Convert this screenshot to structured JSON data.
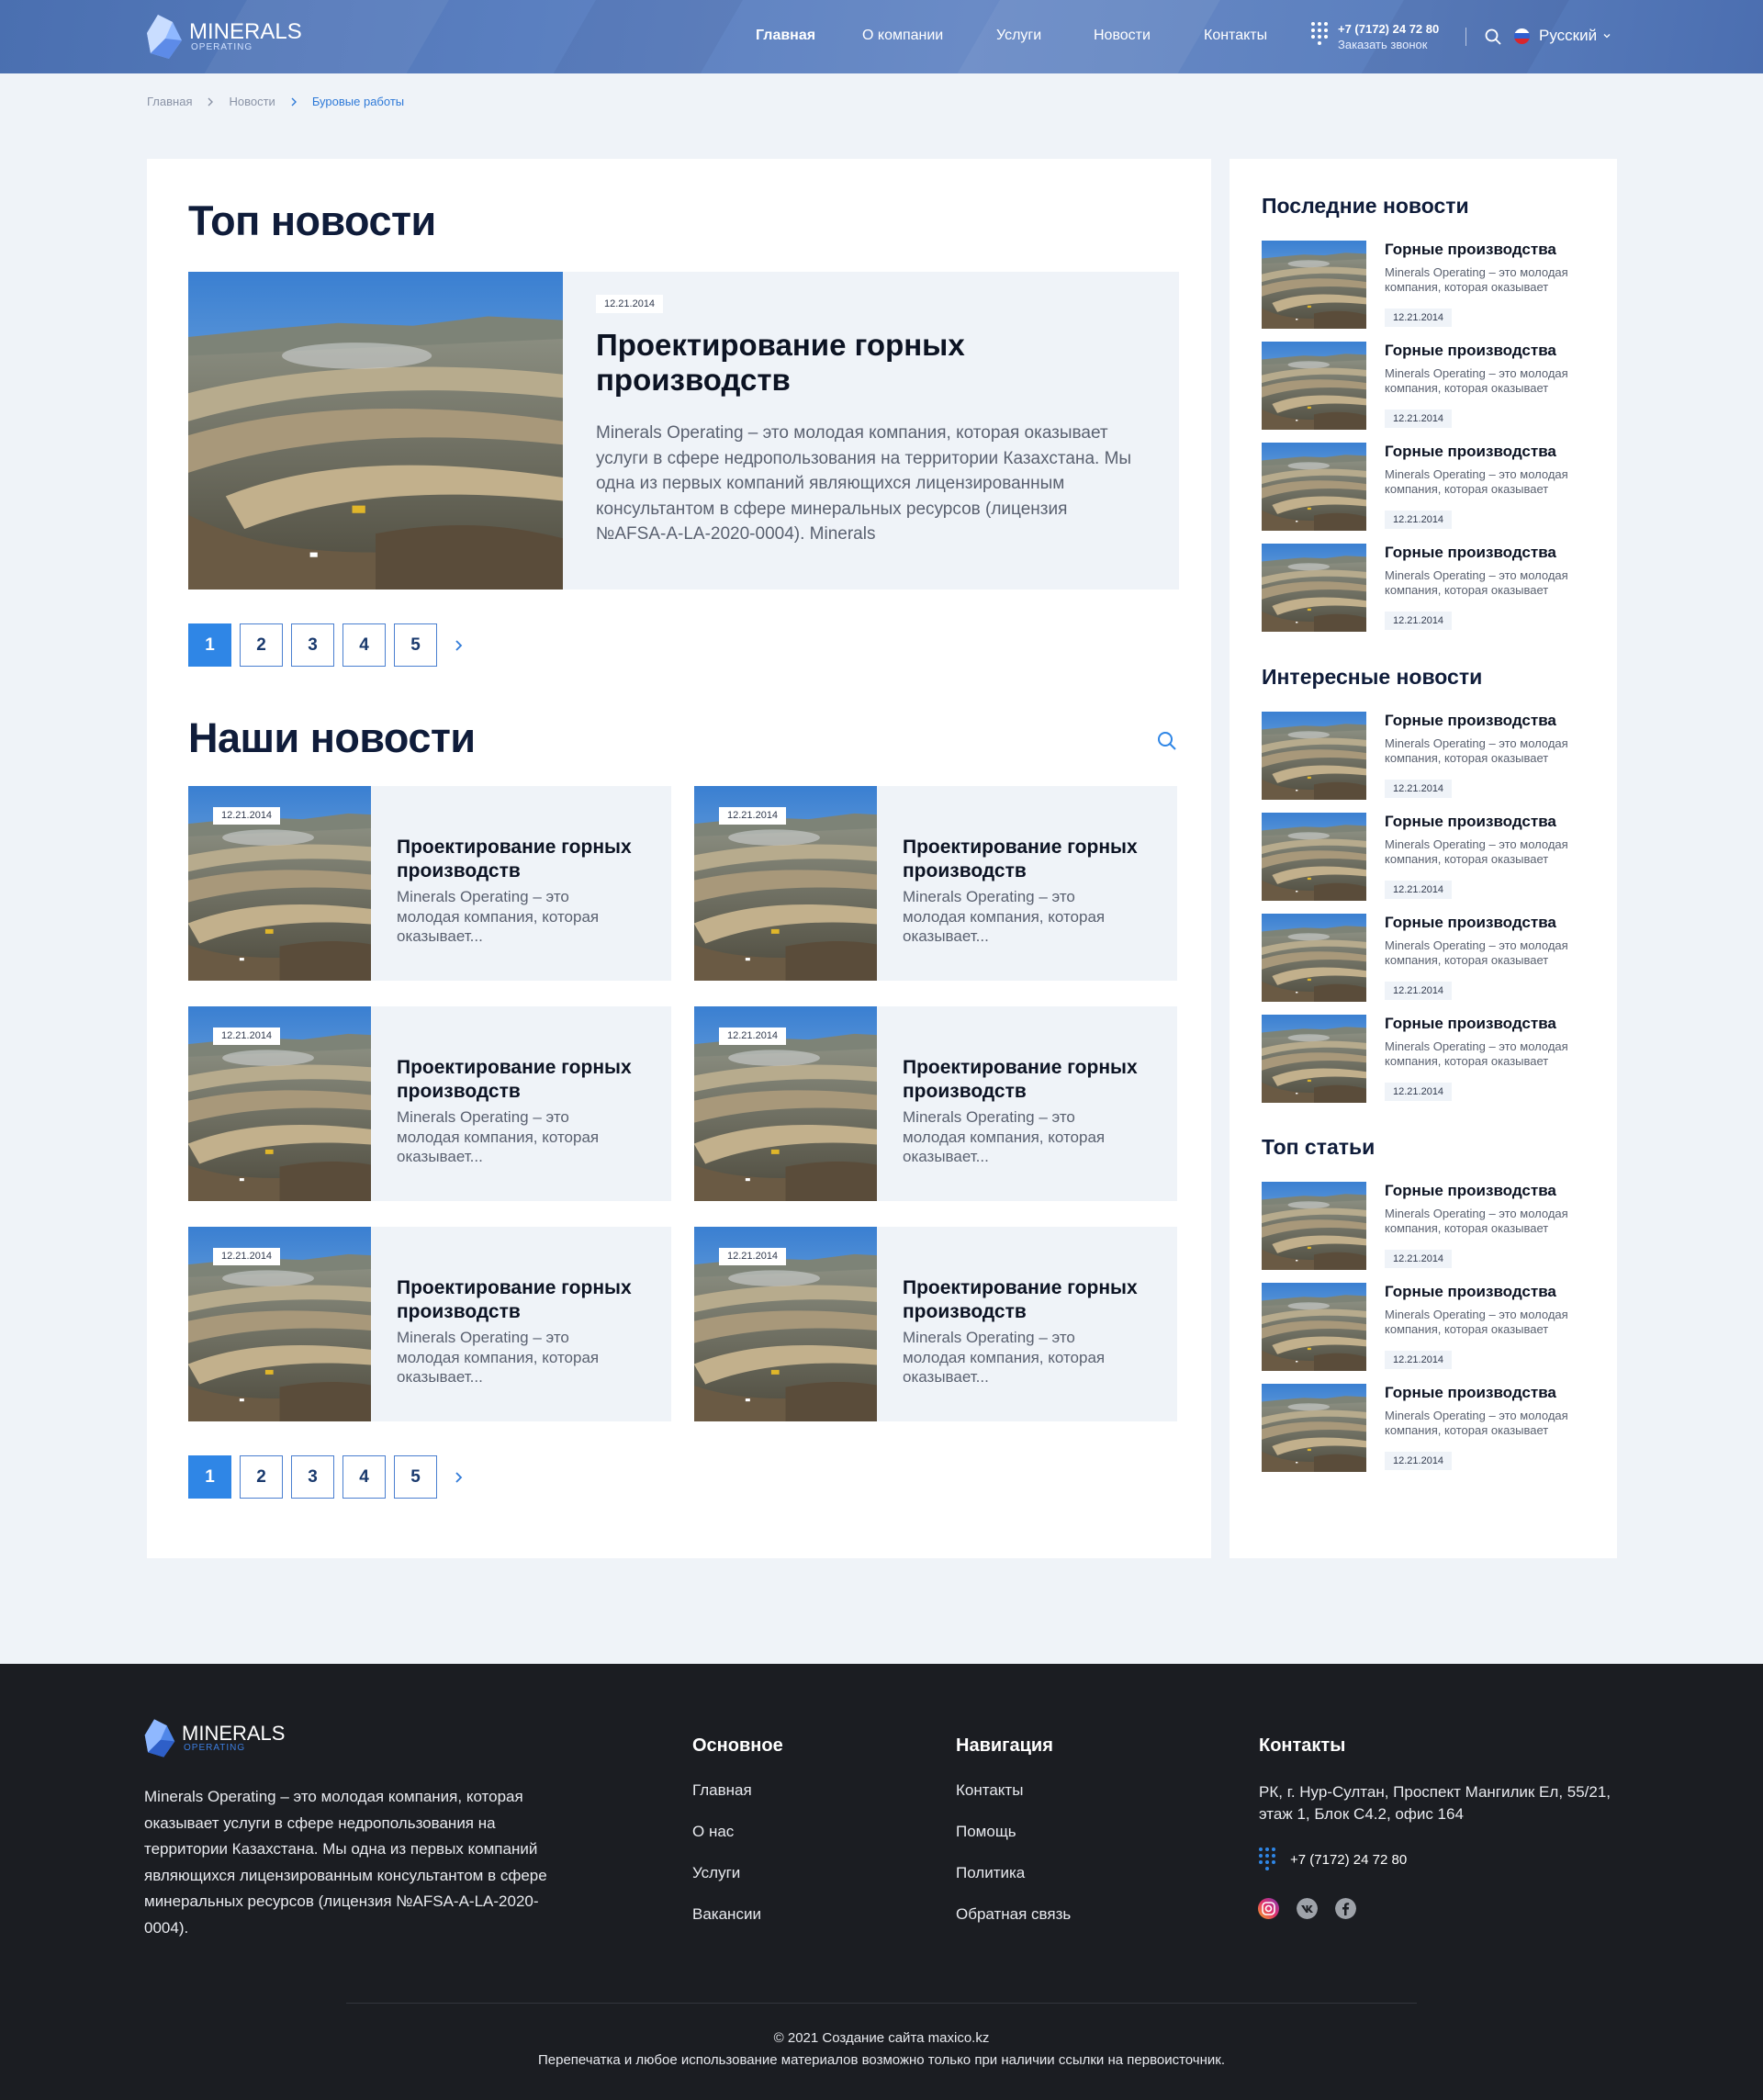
{
  "brand": {
    "name": "MINERALS",
    "sub": "OPERATING"
  },
  "nav": {
    "items": [
      "Главная",
      "О компании",
      "Услуги",
      "Новости",
      "Контакты"
    ],
    "phone": "+7 (7172) 24 72 80",
    "callback": "Заказать звонок",
    "language": "Русский"
  },
  "breadcrumb": [
    "Главная",
    "Новости",
    "Буровые работы"
  ],
  "top_news": {
    "heading": "Топ новости",
    "date": "12.21.2014",
    "title": "Проектирование горных производств",
    "text": "Minerals Operating – это молодая компания, которая оказывает услуги в сфере недропользования на территории Казахстана. Мы одна из первых компаний являющихся лицензированным консультантом в сфере минеральных ресурсов (лицензия №AFSA-A-LA-2020-0004). Minerals"
  },
  "pagination": [
    "1",
    "2",
    "3",
    "4",
    "5"
  ],
  "our_news": {
    "heading": "Наши новости",
    "items": [
      {
        "date": "12.21.2014",
        "title": "Проектирование горных производств",
        "text": "Minerals Operating – это молодая компания, которая оказывает..."
      },
      {
        "date": "12.21.2014",
        "title": "Проектирование горных производств",
        "text": "Minerals Operating – это молодая компания, которая оказывает..."
      },
      {
        "date": "12.21.2014",
        "title": "Проектирование горных производств",
        "text": "Minerals Operating – это молодая компания, которая оказывает..."
      },
      {
        "date": "12.21.2014",
        "title": "Проектирование горных производств",
        "text": "Minerals Operating – это молодая компания, которая оказывает..."
      },
      {
        "date": "12.21.2014",
        "title": "Проектирование горных производств",
        "text": "Minerals Operating – это молодая компания, которая оказывает..."
      },
      {
        "date": "12.21.2014",
        "title": "Проектирование горных производств",
        "text": "Minerals Operating – это молодая компания, которая оказывает..."
      }
    ]
  },
  "sidebar": {
    "sections": [
      {
        "heading": "Последние новости",
        "items": [
          {
            "title": "Горные производства",
            "text": "Minerals Operating – это молодая компания, которая оказывает",
            "date": "12.21.2014"
          },
          {
            "title": "Горные производства",
            "text": "Minerals Operating – это молодая компания, которая оказывает",
            "date": "12.21.2014"
          },
          {
            "title": "Горные производства",
            "text": "Minerals Operating – это молодая компания, которая оказывает",
            "date": "12.21.2014"
          },
          {
            "title": "Горные производства",
            "text": "Minerals Operating – это молодая компания, которая оказывает",
            "date": "12.21.2014"
          }
        ]
      },
      {
        "heading": "Интересные новости",
        "items": [
          {
            "title": "Горные производства",
            "text": "Minerals Operating – это молодая компания, которая оказывает",
            "date": "12.21.2014"
          },
          {
            "title": "Горные производства",
            "text": "Minerals Operating – это молодая компания, которая оказывает",
            "date": "12.21.2014"
          },
          {
            "title": "Горные производства",
            "text": "Minerals Operating – это молодая компания, которая оказывает",
            "date": "12.21.2014"
          },
          {
            "title": "Горные производства",
            "text": "Minerals Operating – это молодая компания, которая оказывает",
            "date": "12.21.2014"
          }
        ]
      },
      {
        "heading": "Топ статьи",
        "items": [
          {
            "title": "Горные производства",
            "text": "Minerals Operating – это молодая компания, которая оказывает",
            "date": "12.21.2014"
          },
          {
            "title": "Горные производства",
            "text": "Minerals Operating – это молодая компания, которая оказывает",
            "date": "12.21.2014"
          },
          {
            "title": "Горные производства",
            "text": "Minerals Operating – это молодая компания, которая оказывает",
            "date": "12.21.2014"
          }
        ]
      }
    ]
  },
  "footer": {
    "description": "Minerals Operating – это молодая компания, которая оказывает услуги в сфере недропользования на территории Казахстана. Мы одна из первых компаний являющихся лицензированным консультантом в сфере минеральных ресурсов (лицензия №AFSA-A-LA-2020-0004).",
    "main": {
      "heading": "Основное",
      "links": [
        "Главная",
        "О нас",
        "Услуги",
        "Вакансии"
      ]
    },
    "navigation": {
      "heading": "Навигация",
      "links": [
        "Контакты",
        "Помощь",
        "Политика",
        "Обратная связь"
      ]
    },
    "contacts": {
      "heading": "Контакты",
      "address": "РК, г. Нур-Султан, Проспект Мангилик Ел, 55/21, этаж 1, Блок С4.2, офис 164",
      "phone": "+7 (7172) 24 72 80",
      "social": [
        "instagram-icon",
        "vk-icon",
        "facebook-icon"
      ]
    },
    "copyright": "© 2021 Создание сайта maxico.kz",
    "notice": "Перепечатка и любое использование материалов возможно только при наличии ссылки на первоисточник."
  },
  "colors": {
    "accent": "#2f86e6",
    "header": "#5a7fc0",
    "footer": "#1b1d22",
    "page_bg": "#eff3f8"
  }
}
